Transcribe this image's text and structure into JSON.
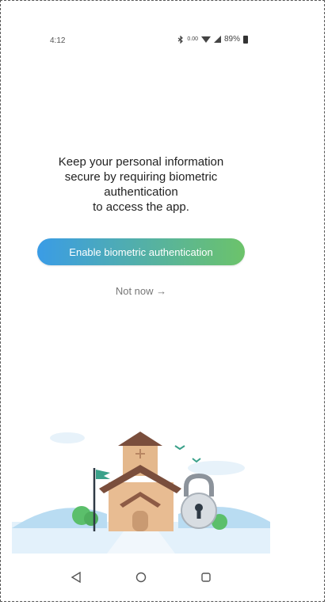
{
  "status_bar": {
    "time": "4:12",
    "network_rate": "0.00",
    "battery": "89%",
    "icons": [
      "bluetooth-icon",
      "wifi-icon",
      "signal-icon",
      "battery-icon"
    ]
  },
  "main": {
    "message": "Keep your personal information\nsecure by requiring biometric\nauthentication\nto access the app.",
    "enable_button_label": "Enable biometric authentication",
    "not_now_label": "Not now →"
  },
  "colors": {
    "button_gradient_start": "#3a9ce6",
    "button_gradient_end": "#6cc36a"
  },
  "nav_bar": {
    "icons": [
      "back-icon",
      "home-icon",
      "recents-icon"
    ]
  }
}
